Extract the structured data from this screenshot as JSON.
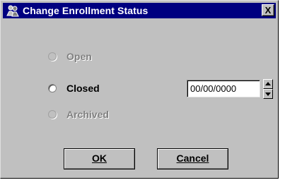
{
  "window": {
    "title": "Change Enrollment Status",
    "icon": "people-icon",
    "close_label": "X"
  },
  "status_options": [
    {
      "label": "Open",
      "enabled": false,
      "selected": false
    },
    {
      "label": "Closed",
      "enabled": true,
      "selected": false
    },
    {
      "label": "Archived",
      "enabled": false,
      "selected": false
    }
  ],
  "date_field": {
    "value": "00/00/0000"
  },
  "buttons": {
    "ok": "OK",
    "cancel": "Cancel"
  },
  "colors": {
    "titlebar": "#000080",
    "face": "#c0c0c0"
  }
}
